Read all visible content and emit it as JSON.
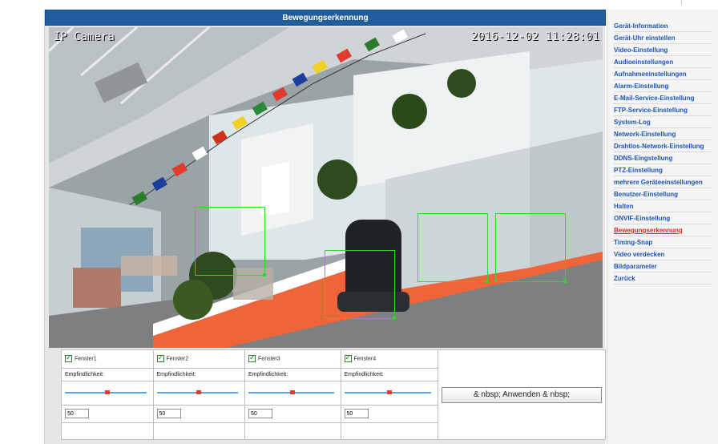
{
  "title": "Bewegungserkennung",
  "camera": {
    "label": "IP Camera",
    "timestamp": "2016-12-02 11:28:01",
    "detection_zone_color": "#34d52e"
  },
  "windows": [
    {
      "label": "Fenster1",
      "checked": true,
      "sensitivity_label": "Empfindlichkeit:",
      "level": 50,
      "level_text": "50"
    },
    {
      "label": "Fenster2",
      "checked": true,
      "sensitivity_label": "Empfindlichkeit:",
      "level": 50,
      "level_text": "50"
    },
    {
      "label": "Fenster3",
      "checked": true,
      "sensitivity_label": "Empfindlichkeit:",
      "level": 50,
      "level_text": "50"
    },
    {
      "label": "Fenster4",
      "checked": true,
      "sensitivity_label": "Empfindlichkeit:",
      "level": 50,
      "level_text": "50"
    }
  ],
  "apply_button": "& nbsp; Anwenden & nbsp;",
  "menu": {
    "active_color": "#e0261f",
    "link_color": "#1e55b3",
    "items": [
      "Gerät-Information",
      "Gerät-Uhr einstellen",
      "Video-Einstellung",
      "Audioeinstellungen",
      "Aufnahmeeinstellungen",
      "Alarm-Einstellung",
      "E-Mail-Service-Einstellung",
      "FTP-Service-Einstellung",
      "System-Log",
      "Network-Einstellung",
      "Drahtlos-Network-Einstellung",
      "DDNS-Eingstellung",
      "PTZ-Einstellung",
      "mehrere Geräteeinstellungen",
      "Benutzer-Einstellung",
      "Halten",
      "ONVIF-Einstellung",
      "Bewegungserkennung",
      "Timing-Snap",
      "Video verdecken",
      "Bildparameter",
      "Zurück"
    ],
    "active_index": 17
  }
}
